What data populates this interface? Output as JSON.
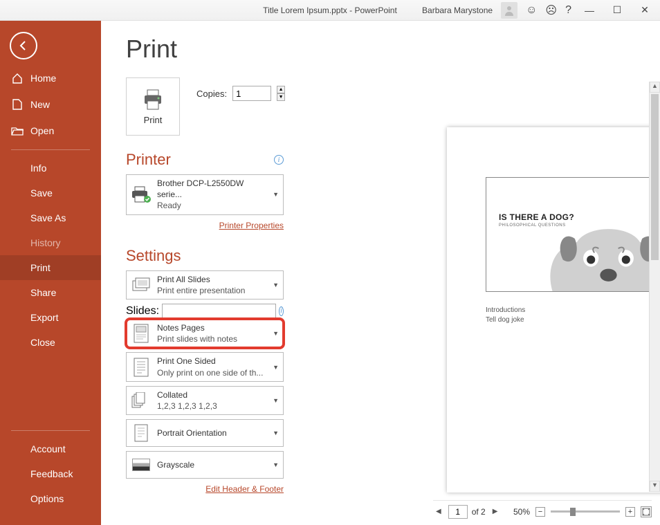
{
  "titlebar": {
    "document_title": "Title Lorem Ipsum.pptx  -  PowerPoint",
    "user_name": "Barbara Marystone"
  },
  "sidebar": {
    "home": "Home",
    "new": "New",
    "open": "Open",
    "info": "Info",
    "save": "Save",
    "save_as": "Save As",
    "history": "History",
    "print": "Print",
    "share": "Share",
    "export": "Export",
    "close": "Close",
    "account": "Account",
    "feedback": "Feedback",
    "options": "Options"
  },
  "page": {
    "title": "Print",
    "print_button": "Print",
    "copies_label": "Copies:",
    "copies_value": "1"
  },
  "printer": {
    "heading": "Printer",
    "name": "Brother DCP-L2550DW serie...",
    "status": "Ready",
    "properties_link": "Printer Properties"
  },
  "settings": {
    "heading": "Settings",
    "slides_label": "Slides:",
    "slides_value": "",
    "what_to_print": {
      "main": "Print All Slides",
      "sub": "Print entire presentation"
    },
    "layout": {
      "main": "Notes Pages",
      "sub": "Print slides with notes"
    },
    "sides": {
      "main": "Print One Sided",
      "sub": "Only print on one side of th..."
    },
    "collate": {
      "main": "Collated",
      "sub": "1,2,3    1,2,3    1,2,3"
    },
    "orientation": {
      "main": "Portrait Orientation"
    },
    "color": {
      "main": "Grayscale"
    },
    "edit_header_footer": "Edit Header & Footer"
  },
  "preview": {
    "slide_title": "IS THERE A DOG?",
    "slide_subtitle": "PHILOSOPHICAL QUESTIONS",
    "notes_line1": "Introductions",
    "notes_line2": "Tell dog joke",
    "page_number": "1"
  },
  "pager": {
    "current": "1",
    "total_label": "of 2"
  },
  "zoom": {
    "percent": "50%"
  }
}
